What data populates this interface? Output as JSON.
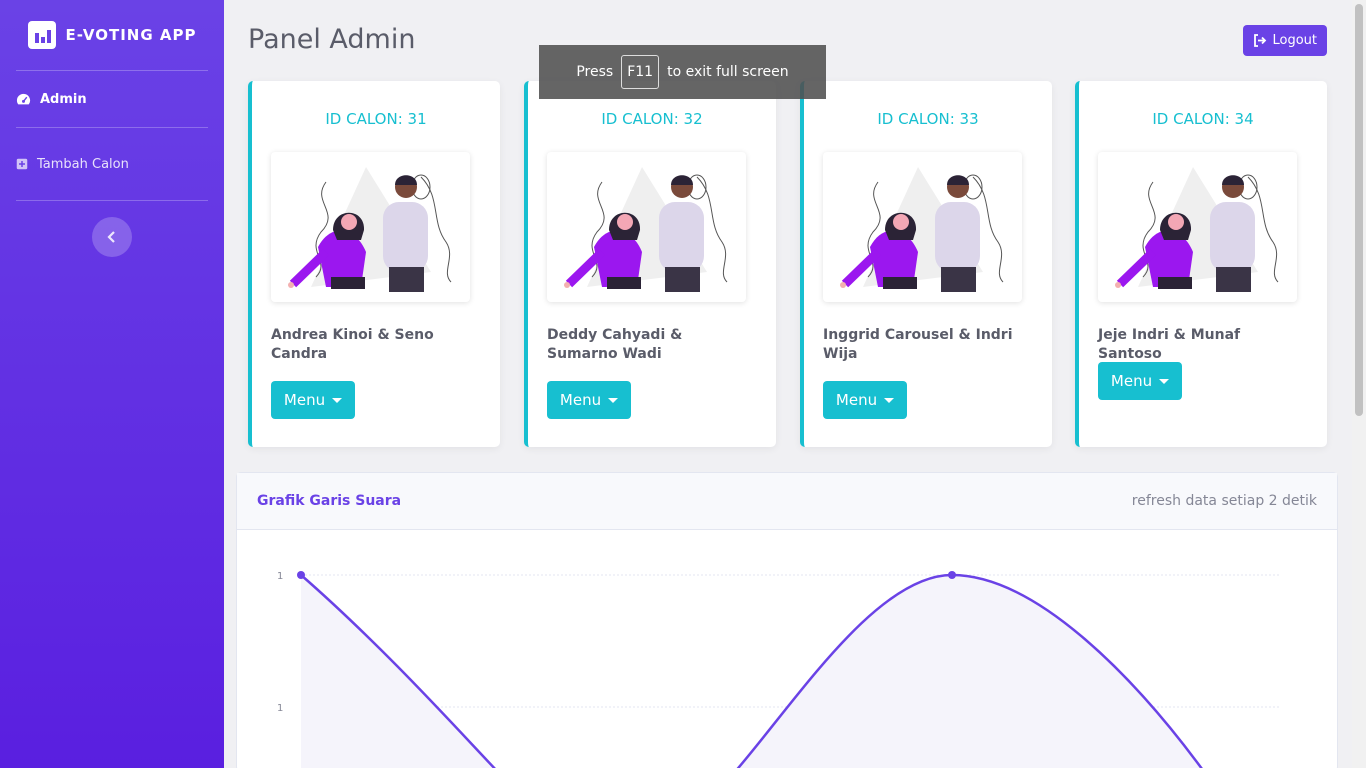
{
  "sidebar": {
    "brand": "E-VOTING APP",
    "items": [
      {
        "label": "Admin",
        "icon": "tachometer-icon"
      },
      {
        "label": "Tambah Calon",
        "icon": "plus-square-icon"
      }
    ],
    "toggle_icon": "chevron-left-icon"
  },
  "header": {
    "title": "Panel Admin",
    "logout_label": "Logout"
  },
  "fullscreen_notice": {
    "press": "Press",
    "key": "F11",
    "rest": "to exit full screen"
  },
  "candidates": [
    {
      "id_label": "ID CALON: 31",
      "name": "Andrea Kinoi & Seno Candra",
      "menu_label": "Menu"
    },
    {
      "id_label": "ID CALON: 32",
      "name": "Deddy Cahyadi & Sumarno Wadi",
      "menu_label": "Menu"
    },
    {
      "id_label": "ID CALON: 33",
      "name": "Inggrid Carousel & Indri Wija",
      "menu_label": "Menu"
    },
    {
      "id_label": "ID CALON: 34",
      "name": "Jeje Indri & Munaf Santoso",
      "menu_label": "Menu"
    }
  ],
  "chart": {
    "title": "Grafik Garis Suara",
    "note": "refresh data setiap 2 detik"
  },
  "chart_data": {
    "type": "line",
    "y_tick_labels": [
      "1",
      "1"
    ],
    "grid": true,
    "colors": {
      "line": "#6a42e6",
      "fill": "#f5f4fb"
    }
  },
  "colors": {
    "accent": "#6a42e6",
    "info": "#17bfd0"
  }
}
